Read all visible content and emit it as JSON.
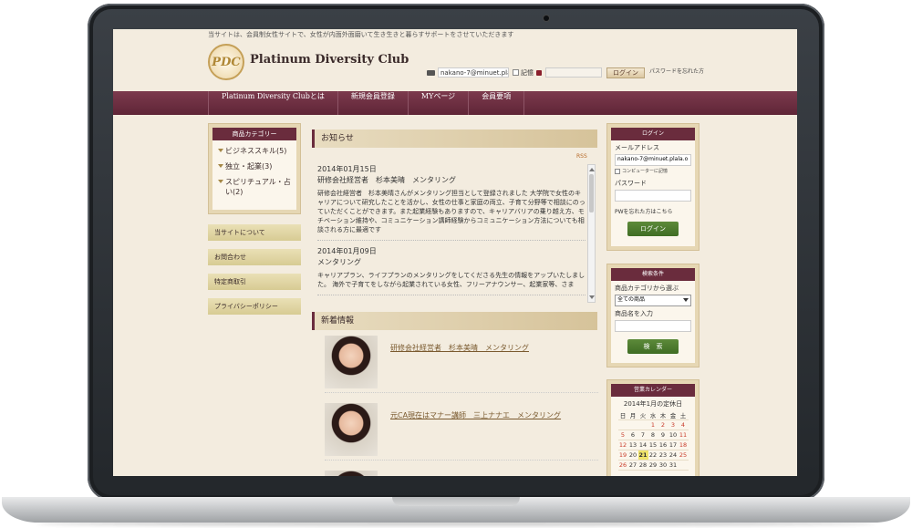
{
  "top_note": "当サイトは、会員制女性サイトで、女性が内面外面磨いて生き生きと暮らすサポートをさせていただきます",
  "logo_text": "PDC",
  "site_title": "Platinum Diversity Club",
  "top_login": {
    "email_value": "nakano-7@minuet.plala.o",
    "remember_label": "記憶",
    "login_button": "ログイン",
    "forgot_text": "パスワードを忘れた方"
  },
  "nav": [
    "Platinum Diversity Clubとは",
    "新規会員登録",
    "MYページ",
    "会員要項"
  ],
  "categories": {
    "header": "商品カテゴリー",
    "items": [
      "ビジネススキル(5)",
      "独立・起業(3)",
      "スピリチュアル・占い(2)"
    ]
  },
  "side_links": [
    "当サイトについて",
    "お問合わせ",
    "特定商取引",
    "プライバシーポリシー"
  ],
  "news": {
    "header": "お知らせ",
    "rss": "RSS",
    "items": [
      {
        "date": "2014年01月15日",
        "title": "研修会社経営者　杉本美晴　メンタリング",
        "body": "研修会社経営者　杉本美晴さんがメンタリング担当として登録されました 大学院で女性のキャリアについて研究したことを活かし、女性の仕事と家庭の両立、子育て分野等で相談にのっていただくことができます。また起業経験もありますので、キャリアバリアの乗り越え方、モチベーション維持や、コミュニケーション講師経験からコミュニケーション方法についても相談される方に最適です"
      },
      {
        "date": "2014年01月09日",
        "title": "メンタリング",
        "body": "キャリアプラン、ライフプランのメンタリングをしてくださる先生の情報をアップいたしました。 海外で子育てをしながら起業されている女性、フリーアナウンサー、起業家等、さま"
      }
    ]
  },
  "new_arrivals": {
    "header": "新着情報",
    "items": [
      "研修会社経営者　杉本美晴　メンタリング",
      "元CA現在はマナー講師　三上ナナエ　メンタリング"
    ]
  },
  "login_box": {
    "header": "ログイン",
    "email_label": "メールアドレス",
    "email_value": "nakano-7@minuet.plala.o",
    "remember_label": "コンピューターに記憶",
    "password_label": "パスワード",
    "forgot_text": "PWを忘れた方はこちら",
    "button": "ログイン"
  },
  "search_box": {
    "header": "検索条件",
    "category_label": "商品カテゴリから選ぶ",
    "category_selected": "全ての商品",
    "name_label": "商品名を入力",
    "button": "検　索"
  },
  "calendar": {
    "header": "営業カレンダー",
    "title": "2014年1月の定休日",
    "weekdays": [
      "日",
      "月",
      "火",
      "水",
      "木",
      "金",
      "土"
    ],
    "weeks": [
      [
        "",
        "",
        "",
        "1",
        "2",
        "3",
        "4"
      ],
      [
        "5",
        "6",
        "7",
        "8",
        "9",
        "10",
        "11"
      ],
      [
        "12",
        "13",
        "14",
        "15",
        "16",
        "17",
        "18"
      ],
      [
        "19",
        "20",
        "21",
        "22",
        "23",
        "24",
        "25"
      ],
      [
        "26",
        "27",
        "28",
        "29",
        "30",
        "31",
        ""
      ]
    ],
    "highlight_color": "#efe36a",
    "holiday_color": "#c83a2a"
  },
  "colors": {
    "nav": "#6a2c3d",
    "button_green": "#4a7a2c",
    "page_bg": "#f3ecdf"
  }
}
